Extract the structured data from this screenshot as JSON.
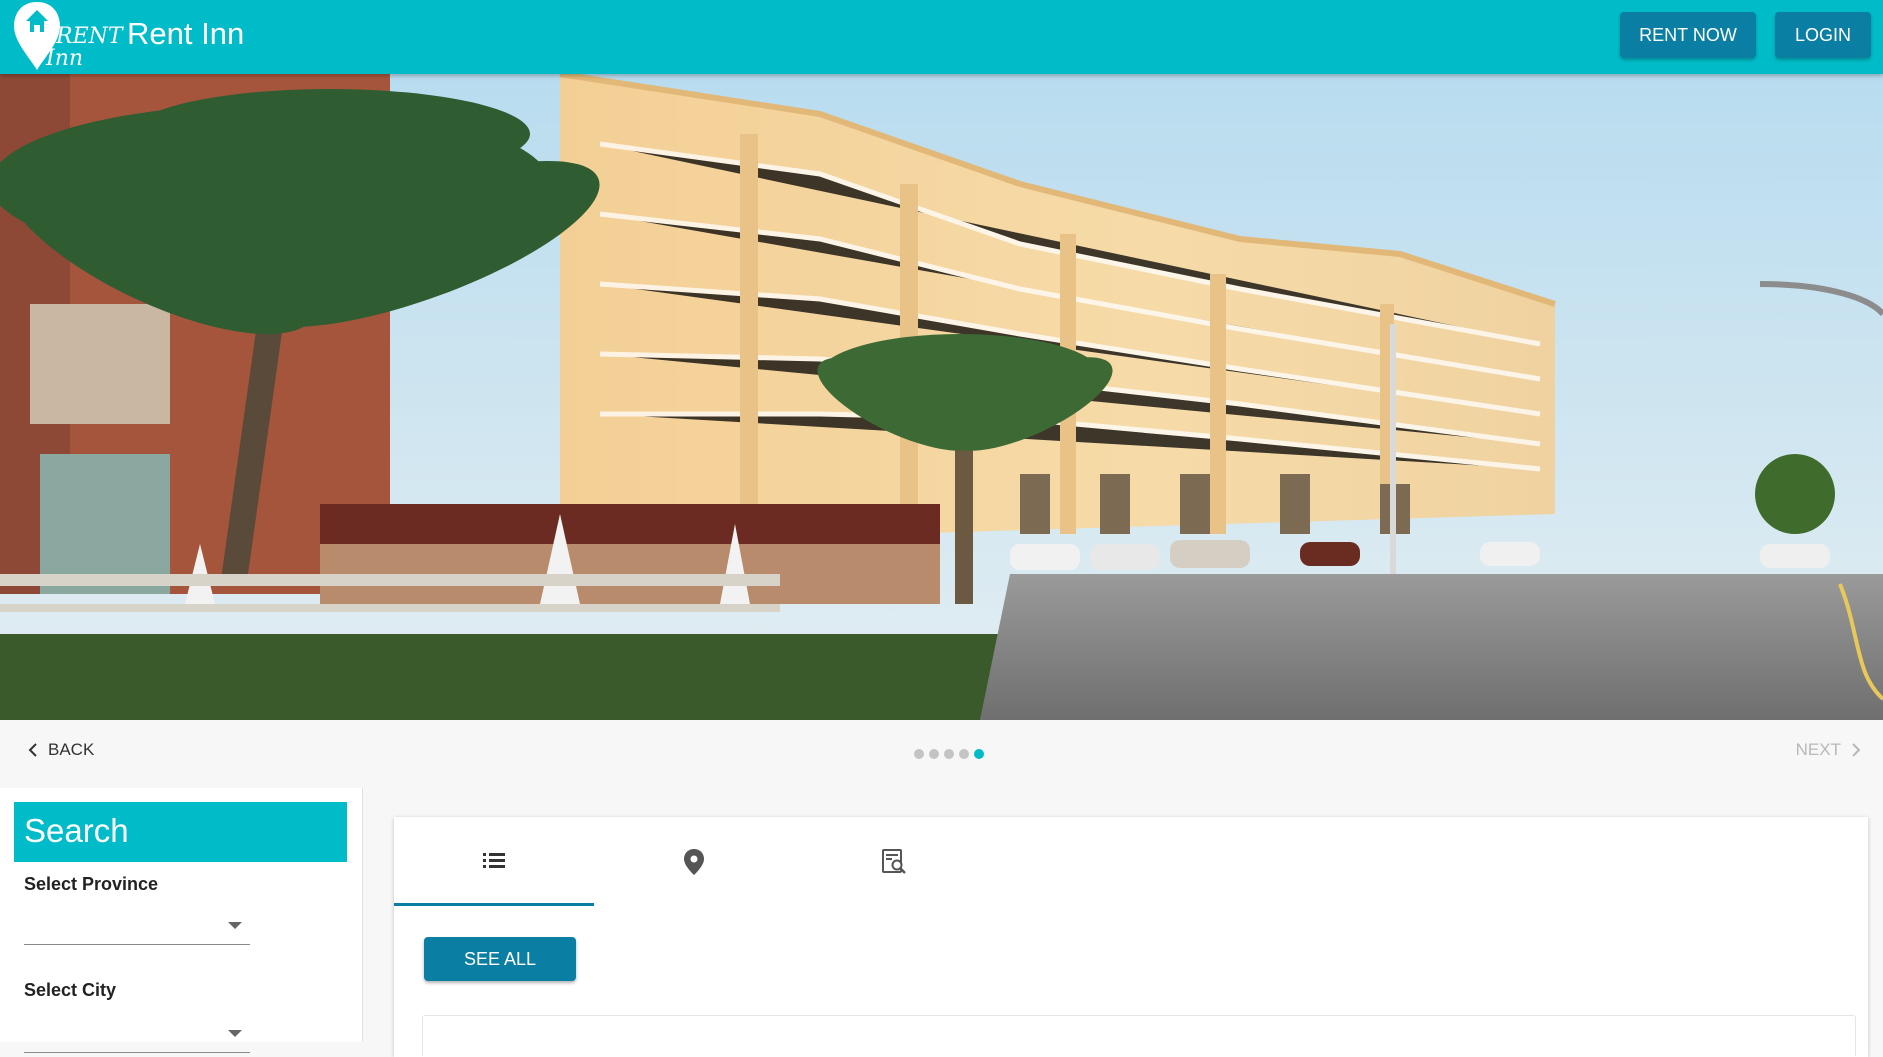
{
  "app": {
    "title": "Rent Inn",
    "logo_text_line1": "RENT",
    "logo_text_line2": "Inn",
    "brand_color": "#00bcc8",
    "button_color": "#0a7fa3"
  },
  "header": {
    "rent_now_label": "RENT NOW",
    "login_label": "LOGIN"
  },
  "hero": {
    "icon": "hotel-building-photo"
  },
  "stepper": {
    "back_label": "BACK",
    "next_label": "NEXT",
    "total_steps": 5,
    "active_step": 5
  },
  "search": {
    "title": "Search",
    "province_label": "Select Province",
    "province_value": "",
    "city_label": "Select City",
    "city_value": ""
  },
  "tabs": [
    {
      "icon": "list-icon",
      "active": true
    },
    {
      "icon": "location-pin-icon",
      "active": false
    },
    {
      "icon": "search-document-icon",
      "active": false
    }
  ],
  "main": {
    "see_all_label": "SEE ALL"
  }
}
